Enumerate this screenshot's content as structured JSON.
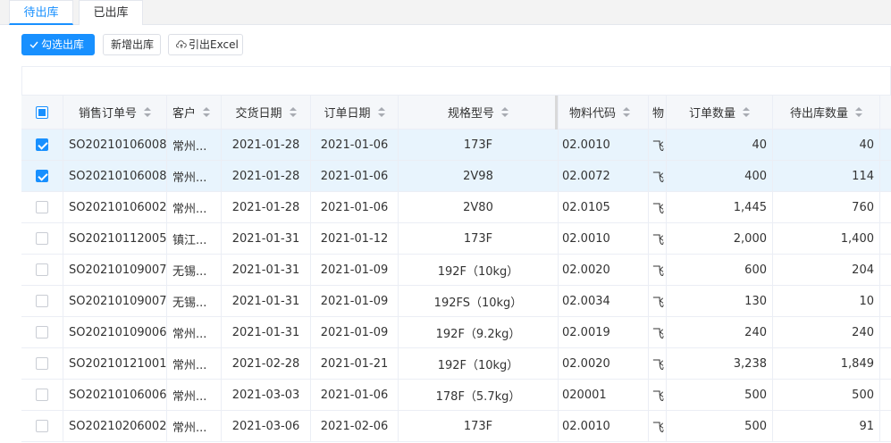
{
  "tabs": [
    {
      "label": "待出库",
      "active": true
    },
    {
      "label": "已出库",
      "active": false
    }
  ],
  "toolbar": {
    "select_label": "勾选出库",
    "new_label": "新增出库",
    "export_label": "引出Excel"
  },
  "table": {
    "columns": [
      "销售订单号",
      "客户",
      "交货日期",
      "订单日期",
      "规格型号",
      "物料代码",
      "物",
      "订单数量",
      "待出库数量"
    ],
    "rows": [
      {
        "checked": true,
        "order_no": "SO20210106008",
        "customer": "常州...",
        "delivery_date": "2021-01-28",
        "order_date": "2021-01-06",
        "spec": "173F",
        "material_code": "02.0010",
        "mat": "飞",
        "order_qty": "40",
        "pending_qty": "40"
      },
      {
        "checked": true,
        "order_no": "SO20210106008",
        "customer": "常州...",
        "delivery_date": "2021-01-28",
        "order_date": "2021-01-06",
        "spec": "2V98",
        "material_code": "02.0072",
        "mat": "飞",
        "order_qty": "400",
        "pending_qty": "114"
      },
      {
        "checked": false,
        "order_no": "SO20210106002",
        "customer": "常州...",
        "delivery_date": "2021-01-28",
        "order_date": "2021-01-06",
        "spec": "2V80",
        "material_code": "02.0105",
        "mat": "飞",
        "order_qty": "1,445",
        "pending_qty": "760"
      },
      {
        "checked": false,
        "order_no": "SO20210112005",
        "customer": "镇江...",
        "delivery_date": "2021-01-31",
        "order_date": "2021-01-12",
        "spec": "173F",
        "material_code": "02.0010",
        "mat": "飞",
        "order_qty": "2,000",
        "pending_qty": "1,400"
      },
      {
        "checked": false,
        "order_no": "SO20210109007",
        "customer": "无锡...",
        "delivery_date": "2021-01-31",
        "order_date": "2021-01-09",
        "spec": "192F（10kg）",
        "material_code": "02.0020",
        "mat": "飞",
        "order_qty": "600",
        "pending_qty": "204"
      },
      {
        "checked": false,
        "order_no": "SO20210109007",
        "customer": "无锡...",
        "delivery_date": "2021-01-31",
        "order_date": "2021-01-09",
        "spec": "192FS（10kg）",
        "material_code": "02.0034",
        "mat": "飞",
        "order_qty": "130",
        "pending_qty": "10"
      },
      {
        "checked": false,
        "order_no": "SO20210109006",
        "customer": "常州...",
        "delivery_date": "2021-01-31",
        "order_date": "2021-01-09",
        "spec": "192F（9.2kg）",
        "material_code": "02.0019",
        "mat": "飞",
        "order_qty": "240",
        "pending_qty": "240"
      },
      {
        "checked": false,
        "order_no": "SO20210121001",
        "customer": "常州...",
        "delivery_date": "2021-02-28",
        "order_date": "2021-01-21",
        "spec": "192F（10kg）",
        "material_code": "02.0020",
        "mat": "飞",
        "order_qty": "3,238",
        "pending_qty": "1,849"
      },
      {
        "checked": false,
        "order_no": "SO20210106006",
        "customer": "常州...",
        "delivery_date": "2021-03-03",
        "order_date": "2021-01-06",
        "spec": "178F（5.7kg）",
        "material_code": "020001",
        "mat": "飞",
        "order_qty": "500",
        "pending_qty": "500"
      },
      {
        "checked": false,
        "order_no": "SO20210206002",
        "customer": "常州...",
        "delivery_date": "2021-03-06",
        "order_date": "2021-02-06",
        "spec": "173F",
        "material_code": "02.0010",
        "mat": "飞",
        "order_qty": "500",
        "pending_qty": "91"
      }
    ]
  },
  "colors": {
    "accent": "#1890ff",
    "selected_row": "#e8f4fd",
    "header_bg": "#f5f7fa",
    "border": "#ebeef5"
  }
}
